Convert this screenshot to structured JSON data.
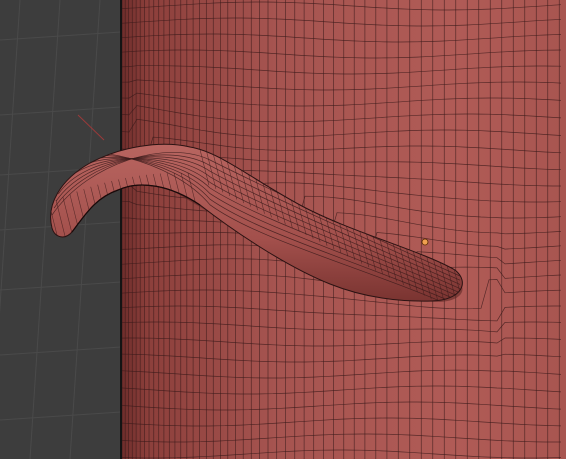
{
  "viewport": {
    "background_color": "#3d3d3d",
    "grid_line_color": "#4a4a4a",
    "axis_line_color": "#9a3a3a"
  },
  "mesh": {
    "object": "cylinder-with-bent-handle",
    "base_color": "#a3504c",
    "shadow_color": "#6e2d2b",
    "highlight_color": "#b86560",
    "wire_color": "#3a1a1a",
    "edge_outline_color": "#141414"
  },
  "origin_marker": {
    "icon": "origin-dot-icon",
    "color": "#f0a050"
  }
}
